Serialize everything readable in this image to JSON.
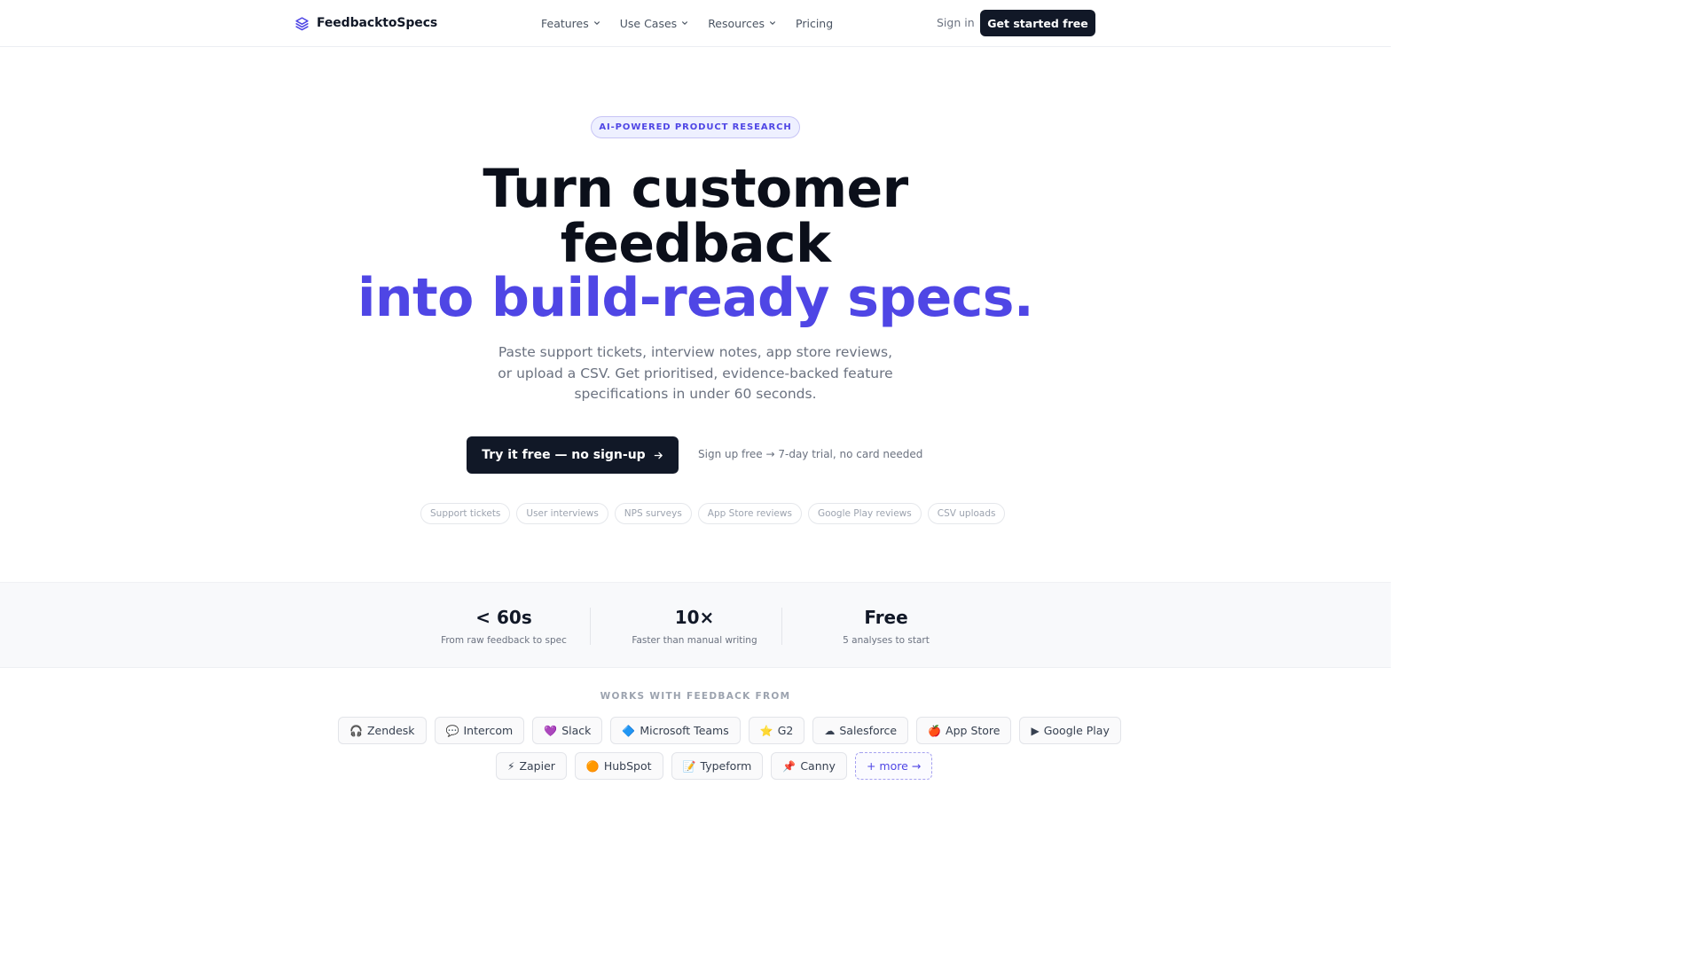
{
  "nav": {
    "brand": "FeedbacktoSpecs",
    "menu": [
      "Features",
      "Use Cases",
      "Resources",
      "Pricing"
    ],
    "signin": "Sign in",
    "cta": "Get started free"
  },
  "hero": {
    "badge": "AI-POWERED PRODUCT RESEARCH",
    "title_line1": "Turn customer",
    "title_line2": "feedback",
    "title_line3": "into build-ready specs.",
    "subtitle": "Paste support tickets, interview notes, app store reviews, or upload a CSV. Get prioritised, evidence-backed feature specifications in under 60 seconds.",
    "primary_button": "Try it free — no sign-up",
    "trial_note": "Sign up free → 7-day trial, no card needed",
    "sources": [
      "Support tickets",
      "User interviews",
      "NPS surveys",
      "App Store reviews",
      "Google Play reviews",
      "CSV uploads"
    ]
  },
  "stats": [
    {
      "value": "< 60s",
      "label": "From raw feedback to spec"
    },
    {
      "value": "10×",
      "label": "Faster than manual writing"
    },
    {
      "value": "Free",
      "label": "5 analyses to start"
    }
  ],
  "integrations": {
    "heading": "WORKS WITH FEEDBACK FROM",
    "row1": [
      {
        "icon": "🎧",
        "name": "Zendesk"
      },
      {
        "icon": "💬",
        "name": "Intercom"
      },
      {
        "icon": "💜",
        "name": "Slack"
      },
      {
        "icon": "🔷",
        "name": "Microsoft Teams"
      },
      {
        "icon": "⭐",
        "name": "G2"
      },
      {
        "icon": "☁",
        "name": "Salesforce"
      },
      {
        "icon": "🍎",
        "name": "App Store"
      },
      {
        "icon": "▶",
        "name": "Google Play"
      }
    ],
    "row2": [
      {
        "icon": "⚡",
        "name": "Zapier"
      },
      {
        "icon": "🟠",
        "name": "HubSpot"
      },
      {
        "icon": "📝",
        "name": "Typeform"
      },
      {
        "icon": "📌",
        "name": "Canny"
      }
    ],
    "more": "+ more →"
  },
  "colors": {
    "accent": "#4f46e5",
    "dark": "#111827",
    "muted": "#6b7280"
  }
}
